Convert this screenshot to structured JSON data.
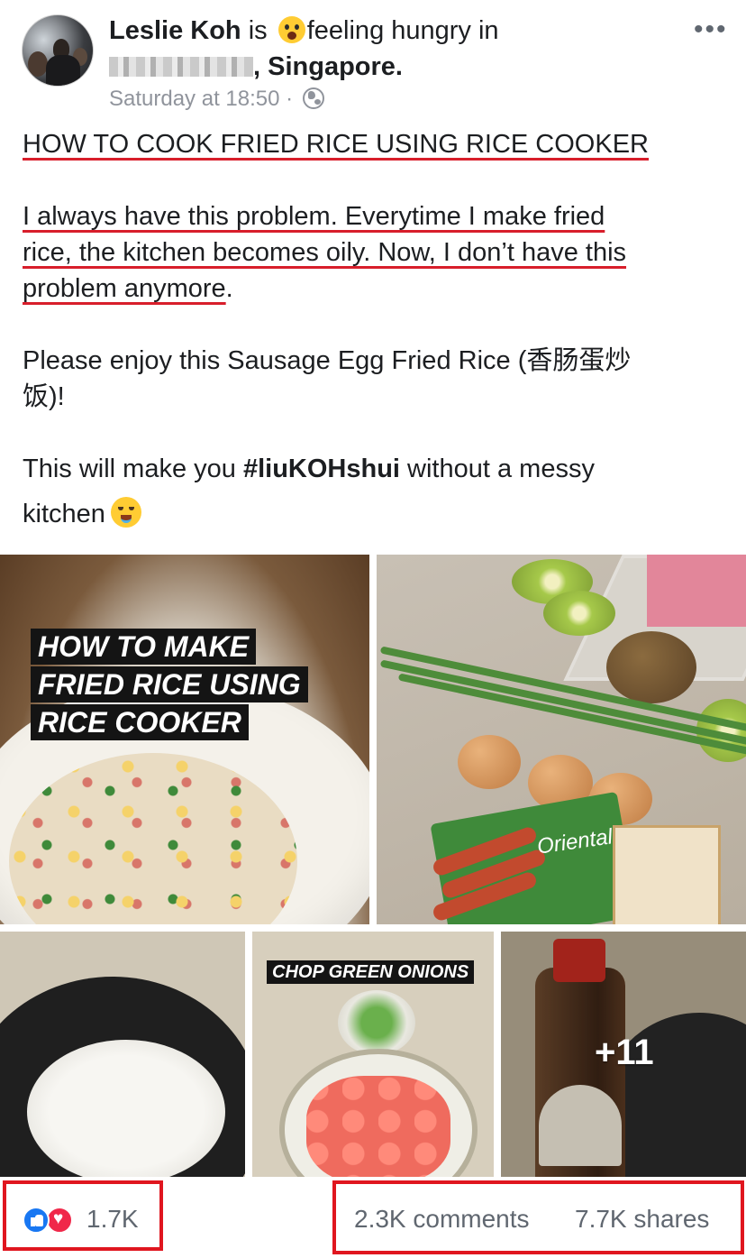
{
  "post": {
    "author": "Leslie Koh",
    "activity_prefix": "is",
    "activity_text": "feeling hungry in",
    "location": ", Singapore.",
    "timestamp": "Saturday at 18:50",
    "separator": "·",
    "privacy_icon": "globe-icon",
    "more_icon": "more-options-icon",
    "more_label": "•••"
  },
  "body": {
    "title": "HOW TO COOK FRIED RICE USING RICE COOKER",
    "para1_line1": "I always have this problem. Everytime I make fried",
    "para1_line2": "rice, the kitchen becomes oily. Now, I don’t have this",
    "para1_line3_underlined": "problem anymore",
    "para1_line3_end": ".",
    "para2_line1": "Please enjoy this Sausage Egg Fried Rice (香肠蛋炒",
    "para2_line2": "饭)!",
    "para3_start": "This will make you ",
    "para3_hashtag": "#liuKOHshui",
    "para3_end": " without a messy",
    "para3_line2": "kitchen"
  },
  "photos": {
    "p1_text_line1": "HOW TO MAKE",
    "p1_text_line2": "FRIED RICE USING",
    "p1_text_line3": "RICE COOKER",
    "p2_pack_label": "Oriental",
    "p4_label": "CHOP GREEN ONIONS",
    "more_count": "+11"
  },
  "stats": {
    "reactions_count": "1.7K",
    "comments": "2.3K comments",
    "shares": "7.7K shares",
    "reaction_icons": [
      "like-icon",
      "love-icon"
    ]
  },
  "colors": {
    "highlight_red": "#e0161f",
    "underline_red": "#d81e2b",
    "like_blue": "#1877f2",
    "love_red": "#f0284a",
    "meta_gray": "#90949c"
  }
}
